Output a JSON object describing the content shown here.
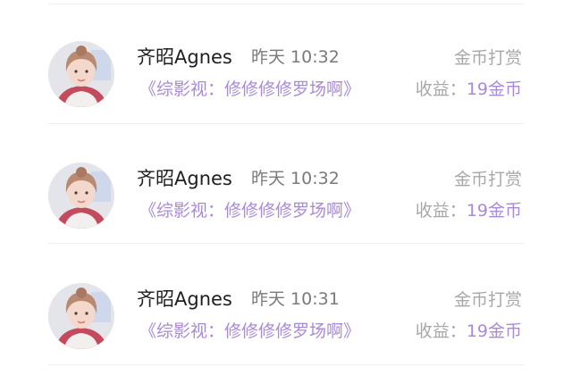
{
  "colors": {
    "accent": "#a98ad6",
    "muted": "#a8a8a8",
    "name": "#1f1f1f"
  },
  "rows": [
    {
      "avatar": "user-avatar",
      "name": "齐昭Agnes",
      "time": "昨天 10:32",
      "reward_type": "金币打赏",
      "video_title": "《综影视：修修修修罗场啊》",
      "earnings_label": "收益：",
      "earnings_value": "19金币"
    },
    {
      "avatar": "user-avatar",
      "name": "齐昭Agnes",
      "time": "昨天 10:32",
      "reward_type": "金币打赏",
      "video_title": "《综影视：修修修修罗场啊》",
      "earnings_label": "收益：",
      "earnings_value": "19金币"
    },
    {
      "avatar": "user-avatar",
      "name": "齐昭Agnes",
      "time": "昨天 10:31",
      "reward_type": "金币打赏",
      "video_title": "《综影视：修修修修罗场啊》",
      "earnings_label": "收益：",
      "earnings_value": "19金币"
    }
  ]
}
